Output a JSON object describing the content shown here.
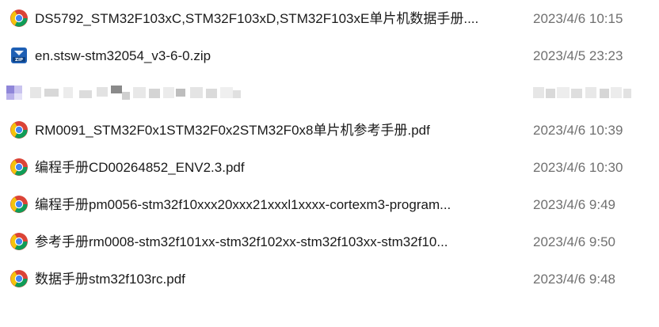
{
  "files": [
    {
      "icon": "chrome-icon",
      "name": "DS5792_STM32F103xC,STM32F103xD,STM32F103xE单片机数据手册....",
      "date": "2023/4/6 10:15"
    },
    {
      "icon": "zip-icon",
      "name": "en.stsw-stm32054_v3-6-0.zip",
      "date": "2023/4/5 23:23"
    },
    {
      "icon": "chrome-icon",
      "name": "RM0091_STM32F0x1STM32F0x2STM32F0x8单片机参考手册.pdf",
      "date": "2023/4/6 10:39"
    },
    {
      "icon": "chrome-icon",
      "name": "编程手册CD00264852_ENV2.3.pdf",
      "date": "2023/4/6 10:30"
    },
    {
      "icon": "chrome-icon",
      "name": "编程手册pm0056-stm32f10xxx20xxx21xxxl1xxxx-cortexm3-program...",
      "date": "2023/4/6 9:49"
    },
    {
      "icon": "chrome-icon",
      "name": "参考手册rm0008-stm32f101xx-stm32f102xx-stm32f103xx-stm32f10...",
      "date": "2023/4/6 9:50"
    },
    {
      "icon": "chrome-icon",
      "name": "数据手册stm32f103rc.pdf",
      "date": "2023/4/6 9:48"
    }
  ],
  "zip_icon_text": "ZIP",
  "colors": {
    "name_text": "#1a1a1a",
    "date_text": "#707070",
    "chrome_red": "#db4437",
    "chrome_yellow": "#f4c20d",
    "chrome_green": "#0f9d58",
    "chrome_blue": "#4285f4",
    "zip_blue": "#1565c0"
  }
}
